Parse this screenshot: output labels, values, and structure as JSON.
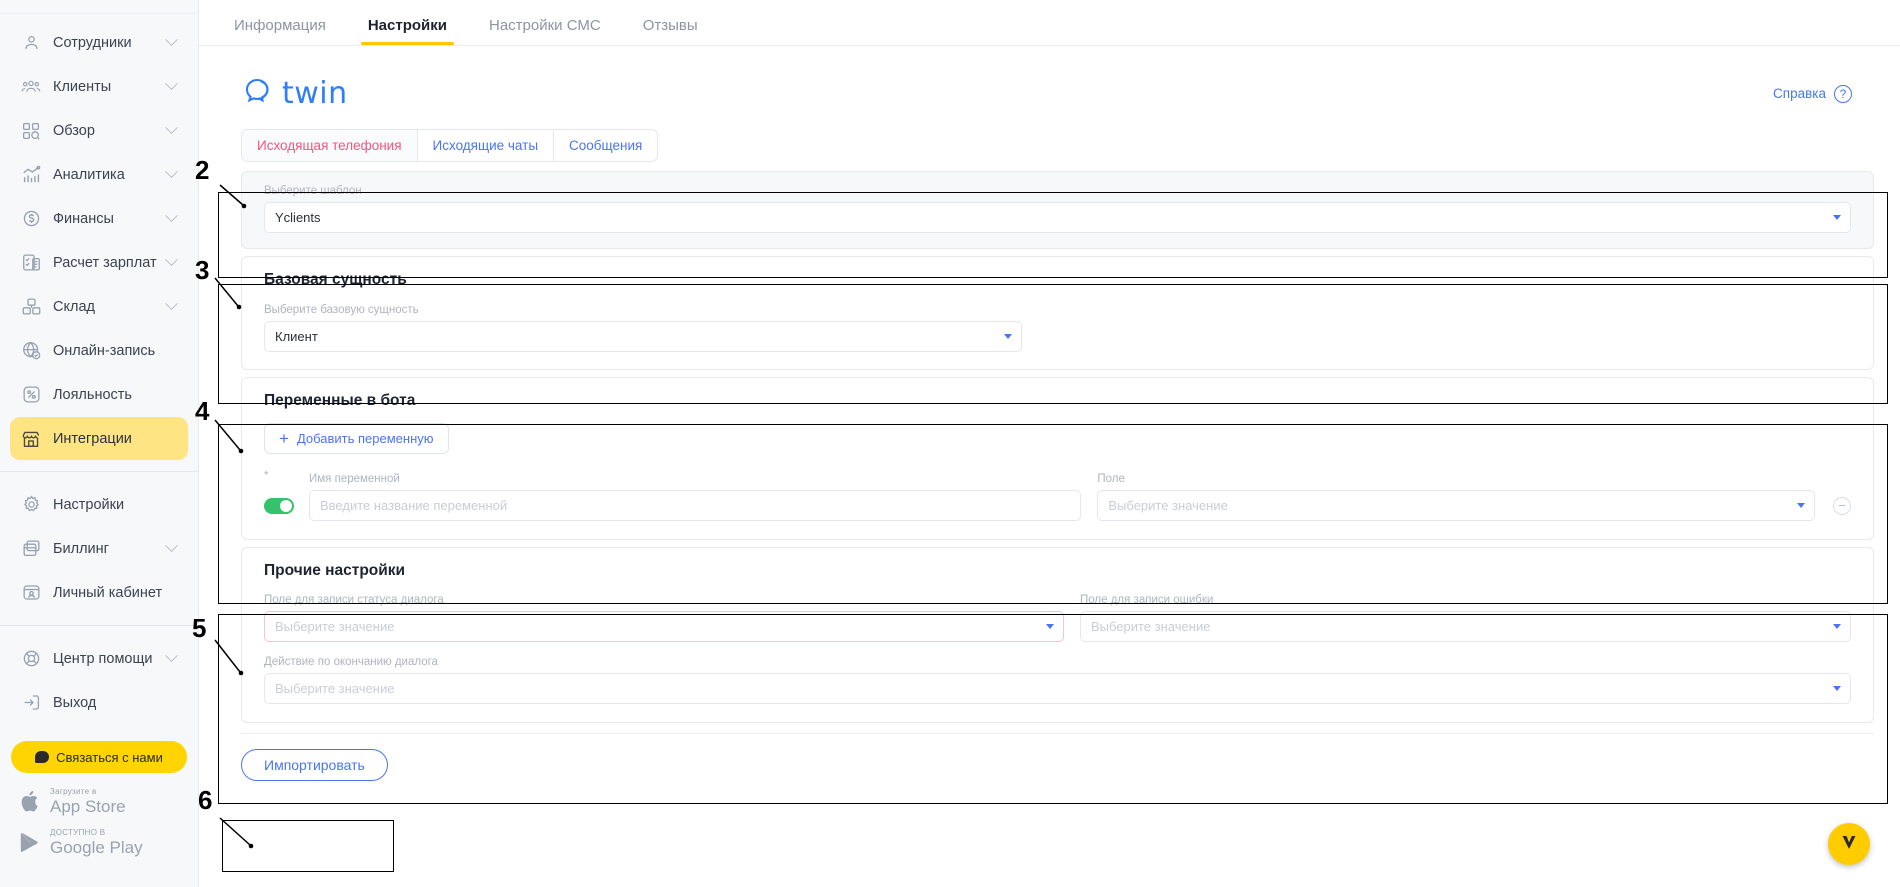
{
  "sidebar": {
    "groups": [
      {
        "items": [
          {
            "label": "Сотрудники",
            "icon": "user-icon",
            "expandable": true,
            "active": false
          },
          {
            "label": "Клиенты",
            "icon": "users-icon",
            "expandable": true,
            "active": false
          },
          {
            "label": "Обзор",
            "icon": "grid-search-icon",
            "expandable": true,
            "active": false
          },
          {
            "label": "Аналитика",
            "icon": "chart-icon",
            "expandable": true,
            "active": false
          },
          {
            "label": "Финансы",
            "icon": "dollar-icon",
            "expandable": true,
            "active": false
          },
          {
            "label": "Расчет зарплат",
            "icon": "checklist-icon",
            "expandable": true,
            "active": false
          },
          {
            "label": "Склад",
            "icon": "warehouse-icon",
            "expandable": true,
            "active": false
          },
          {
            "label": "Онлайн-запись",
            "icon": "globe-check-icon",
            "expandable": false,
            "active": false
          },
          {
            "label": "Лояльность",
            "icon": "percent-icon",
            "expandable": false,
            "active": false
          },
          {
            "label": "Интеграции",
            "icon": "shop-icon",
            "expandable": false,
            "active": true
          }
        ]
      },
      {
        "items": [
          {
            "label": "Настройки",
            "icon": "gear-icon",
            "expandable": false,
            "active": false
          },
          {
            "label": "Биллинг",
            "icon": "cards-icon",
            "expandable": true,
            "active": false
          },
          {
            "label": "Личный кабинет",
            "icon": "profile-card-icon",
            "expandable": false,
            "active": false
          }
        ]
      },
      {
        "items": [
          {
            "label": "Центр помощи",
            "icon": "lifebuoy-icon",
            "expandable": true,
            "active": false
          },
          {
            "label": "Выход",
            "icon": "logout-icon",
            "expandable": false,
            "active": false
          }
        ]
      }
    ],
    "contact_button": "Связаться с нами",
    "stores": [
      {
        "small": "Загрузите в",
        "big": "App Store",
        "icon": "apple-icon"
      },
      {
        "small": "ДОСТУПНО В",
        "big": "Google Play",
        "icon": "google-play-icon"
      }
    ]
  },
  "tabs": [
    {
      "label": "Информация",
      "active": false
    },
    {
      "label": "Настройки",
      "active": true
    },
    {
      "label": "Настройки СМС",
      "active": false
    },
    {
      "label": "Отзывы",
      "active": false
    }
  ],
  "brand": {
    "word": "twin",
    "icon": "twin-logo-icon"
  },
  "help": {
    "label": "Справка",
    "icon": "question-circle-icon"
  },
  "segmented": [
    {
      "label": "Исходящая телефония",
      "active": true
    },
    {
      "label": "Исходящие чаты",
      "active": false
    },
    {
      "label": "Сообщения",
      "active": false
    }
  ],
  "template_section": {
    "field_label": "Выберите шаблон",
    "value": "Yclients"
  },
  "base_entity_section": {
    "title": "Базовая сущность",
    "field_label": "Выберите базовую сущность",
    "value": "Клиент"
  },
  "variables_section": {
    "title": "Переменные в бота",
    "add_button": "Добавить переменную",
    "required_mark": "*",
    "columns": {
      "name": "Имя переменной",
      "field": "Поле"
    },
    "rows": [
      {
        "enabled": true,
        "name_placeholder": "Введите название переменной",
        "name_value": "",
        "field_placeholder": "Выберите значение",
        "field_value": "",
        "remove_label": "−"
      }
    ]
  },
  "other_section": {
    "title": "Прочие настройки",
    "fields": [
      {
        "label": "Поле для записи статуса диалога",
        "placeholder": "Выберите значение",
        "value": "",
        "error": true
      },
      {
        "label": "Поле для записи ошибки",
        "placeholder": "Выберите значение",
        "value": "",
        "error": false
      },
      {
        "label": "Действие по окончанию диалога",
        "placeholder": "Выберите значение",
        "value": "",
        "error": false
      }
    ]
  },
  "footer": {
    "import_button": "Импортировать"
  },
  "annotations": [
    {
      "number": "2"
    },
    {
      "number": "3"
    },
    {
      "number": "4"
    },
    {
      "number": "5"
    },
    {
      "number": "6"
    }
  ],
  "fab": {
    "icon": "widget-icon"
  },
  "colors": {
    "accent_yellow": "#ffd400",
    "active_nav": "#ffe484",
    "link_blue": "#4a74f5",
    "brand_blue": "#2f7dfd",
    "active_seg_pink": "#f2567c",
    "toggle_green": "#34c36a",
    "error_border": "#f3c4cf"
  }
}
